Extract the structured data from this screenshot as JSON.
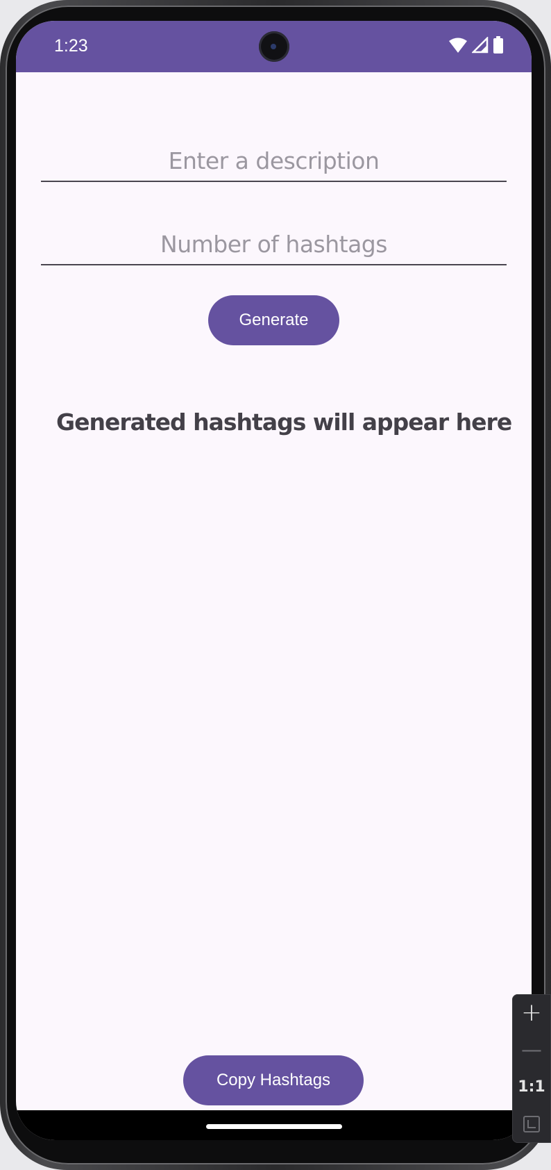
{
  "status_bar": {
    "time": "1:23",
    "icons": [
      "wifi-icon",
      "cellular-signal-icon",
      "battery-icon"
    ]
  },
  "form": {
    "description_input": {
      "value": "",
      "placeholder": "Enter a description"
    },
    "count_input": {
      "value": "",
      "placeholder": "Number of hashtags"
    },
    "generate_label": "Generate"
  },
  "result": {
    "text": "Generated hashtags will appear here"
  },
  "copy_label": "Copy Hashtags",
  "zoom_controls": {
    "zoom_in_icon": "+",
    "zoom_out_icon": "—",
    "ratio_label": "1:1"
  },
  "colors": {
    "primary": "#6552a0",
    "background": "#fcf7fd",
    "result_text": "#434048",
    "placeholder": "#9b97a0"
  }
}
